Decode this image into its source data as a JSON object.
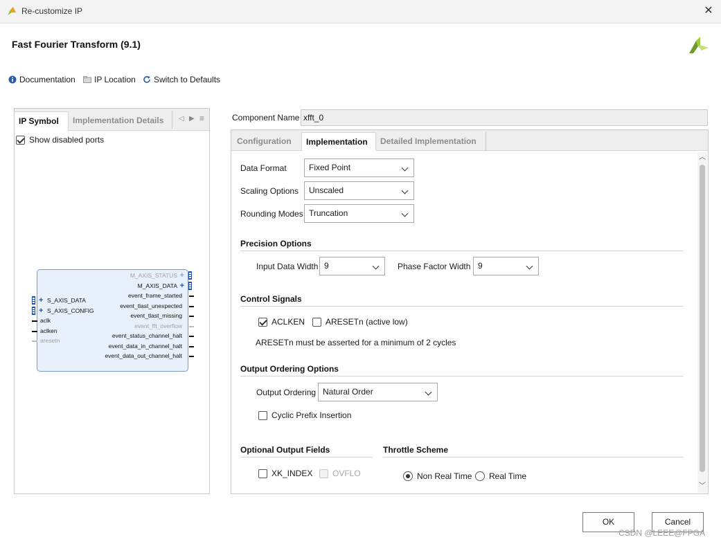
{
  "window": {
    "title": "Re-customize IP",
    "close_icon": "close-icon"
  },
  "header": {
    "ip_title": "Fast Fourier Transform (9.1)",
    "brand_icon": "vivado-logo-icon",
    "brand_color": "#8fbf2a"
  },
  "toolbar": {
    "documentation": "Documentation",
    "ip_location": "IP Location",
    "switch_defaults": "Switch to Defaults"
  },
  "left_panel": {
    "tabs": [
      "IP Symbol",
      "Implementation Details"
    ],
    "active_tab": "IP Symbol",
    "show_disabled_label": "Show disabled ports",
    "show_disabled_checked": true,
    "symbol": {
      "left_ports": [
        {
          "name": "S_AXIS_DATA",
          "bus": true,
          "disabled": false
        },
        {
          "name": "S_AXIS_CONFIG",
          "bus": true,
          "disabled": false
        },
        {
          "name": "aclk",
          "bus": false,
          "disabled": false
        },
        {
          "name": "aclken",
          "bus": false,
          "disabled": false
        },
        {
          "name": "aresetn",
          "bus": false,
          "disabled": true
        }
      ],
      "right_ports": [
        {
          "name": "M_AXIS_STATUS",
          "bus": true,
          "disabled": true
        },
        {
          "name": "M_AXIS_DATA",
          "bus": true,
          "disabled": false
        },
        {
          "name": "event_frame_started",
          "bus": false,
          "disabled": false
        },
        {
          "name": "event_tlast_unexpected",
          "bus": false,
          "disabled": false
        },
        {
          "name": "event_tlast_missing",
          "bus": false,
          "disabled": false
        },
        {
          "name": "event_fft_overflow",
          "bus": false,
          "disabled": true
        },
        {
          "name": "event_status_channel_halt",
          "bus": false,
          "disabled": false
        },
        {
          "name": "event_data_in_channel_halt",
          "bus": false,
          "disabled": false
        },
        {
          "name": "event_data_out_channel_halt",
          "bus": false,
          "disabled": false
        }
      ]
    }
  },
  "component": {
    "label": "Component Name",
    "value": "xfft_0"
  },
  "right_panel": {
    "tabs": [
      "Configuration",
      "Implementation",
      "Detailed Implementation"
    ],
    "active_tab": "Implementation",
    "data_format": {
      "label": "Data Format",
      "value": "Fixed Point"
    },
    "scaling_options": {
      "label": "Scaling Options",
      "value": "Unscaled"
    },
    "rounding_modes": {
      "label": "Rounding Modes",
      "value": "Truncation"
    },
    "precision": {
      "title": "Precision Options",
      "input_width_label": "Input Data Width",
      "input_width_value": "9",
      "phase_width_label": "Phase Factor Width",
      "phase_width_value": "9"
    },
    "control": {
      "title": "Control Signals",
      "aclken_label": "ACLKEN",
      "aclken_checked": true,
      "aresetn_label": "ARESETn (active low)",
      "aresetn_checked": false,
      "note": "ARESETn must be asserted for a minimum of 2 cycles"
    },
    "ordering": {
      "title": "Output Ordering Options",
      "label": "Output Ordering",
      "value": "Natural Order",
      "cyclic_label": "Cyclic Prefix Insertion",
      "cyclic_checked": false
    },
    "optional_fields": {
      "title": "Optional Output Fields",
      "xk_index_label": "XK_INDEX",
      "xk_index_checked": false,
      "ovflo_label": "OVFLO",
      "ovflo_checked": false
    },
    "throttle": {
      "title": "Throttle Scheme",
      "non_real_time_label": "Non Real Time",
      "real_time_label": "Real Time",
      "selected": "Non Real Time"
    }
  },
  "buttons": {
    "ok": "OK",
    "cancel": "Cancel"
  },
  "watermark": "CSDN @LEEE@FPGA"
}
